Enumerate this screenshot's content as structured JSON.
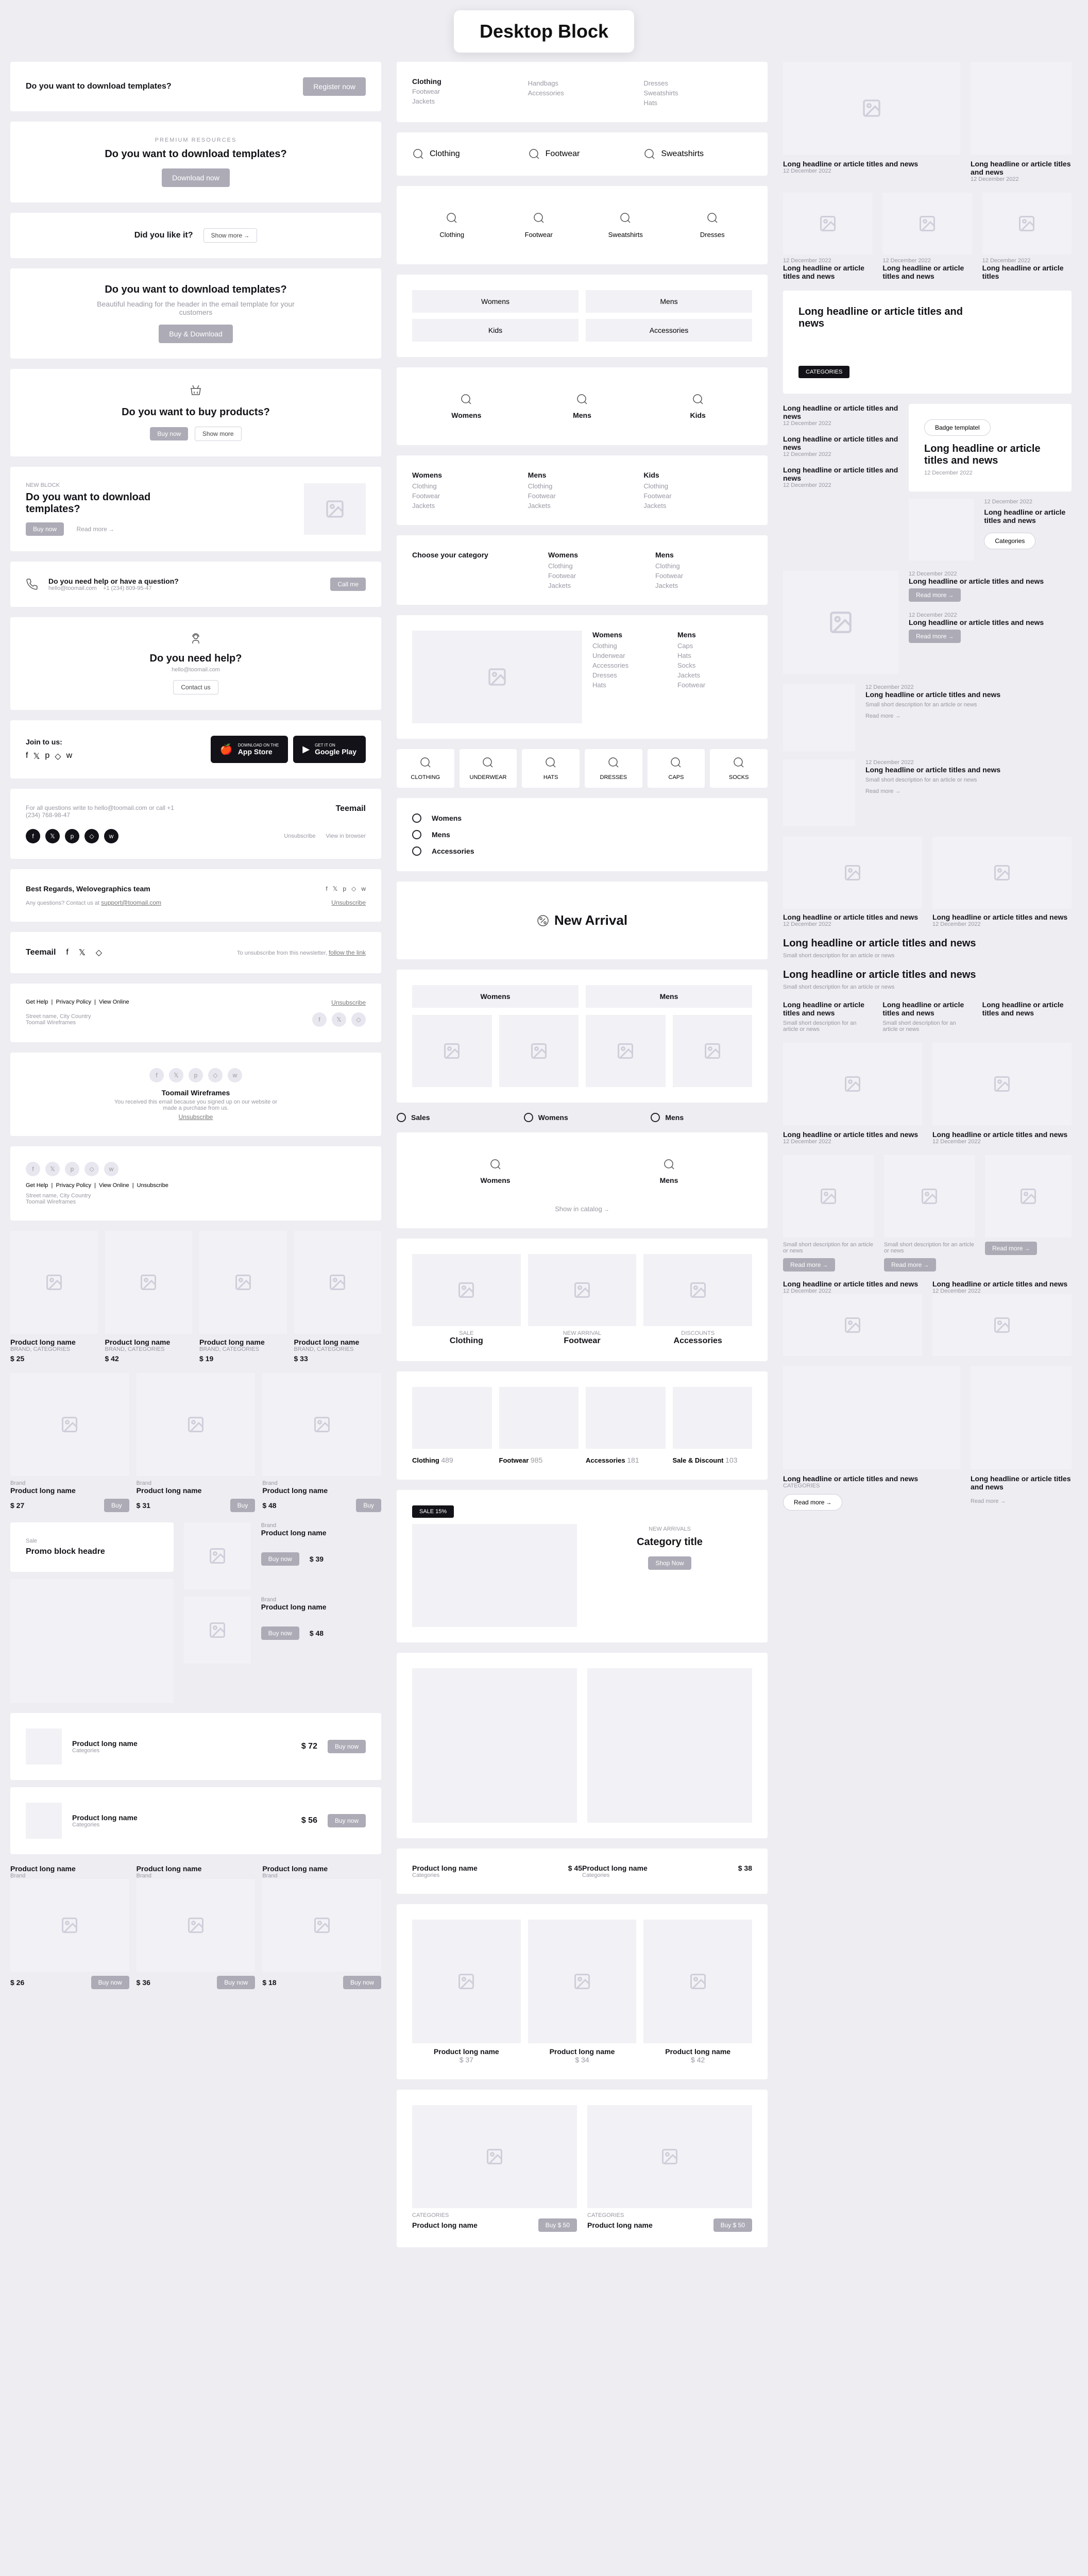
{
  "pageTitle": "Desktop Block",
  "col1": {
    "hero1": {
      "title": "Do you want to download templates?",
      "btn": "Register now"
    },
    "hero2": {
      "over": "PREMIUM RESOURCES",
      "title": "Do you want to download templates?",
      "btn": "Download now"
    },
    "like": {
      "title": "Did you like it?",
      "btn": "Show more"
    },
    "hero3": {
      "title": "Do you want to download templates?",
      "sub": "Beautiful heading for the header in the email template for your customers",
      "btn": "Buy & Download"
    },
    "hero4": {
      "title": "Do you want to buy products?",
      "btn1": "Buy now",
      "btn2": "Show more"
    },
    "hero5": {
      "over": "NEW BLOCK",
      "title": "Do you want to download templates?",
      "btn": "Buy now",
      "link": "Read more"
    },
    "help1": {
      "title": "Do you need help or have a question?",
      "email": "hello@toomail.com",
      "phone": "+1 (234) 809-95-47",
      "btn": "Call me"
    },
    "help2": {
      "title": "Do you need help?",
      "email": "hello@toomail.com",
      "btn": "Contact us"
    },
    "apps": {
      "join": "Join to us:",
      "appstore1": "DOWNLOAD ON THE",
      "appstore2": "App Store",
      "gplay1": "GET IT ON",
      "gplay2": "Google Play"
    },
    "foot1": {
      "text": "For all questions write to hello@toomail.com or call +1 (234) 768-98-47",
      "brand": "Teemail",
      "unsub": "Unsubscribe",
      "view": "View in browser"
    },
    "foot2": {
      "text": "Best Regards, Welovegraphics team",
      "sub": "Any questions? Contact us at ",
      "email": "support@toomail.com",
      "unsub": "Unsubscribe"
    },
    "foot3": {
      "brand": "Teemail",
      "text": "To unsubscribe from this newsletter, ",
      "link": "follow the link"
    },
    "foot4": {
      "l1": "Get Help",
      "l2": "Privacy Policy",
      "l3": "View Online",
      "addr1": "Street name, City Country",
      "addr2": "Toomail Wireframes",
      "unsub": "Unsubscribe"
    },
    "foot5": {
      "brand": "Toomail Wireframes",
      "text": "You received this email because you signed up on our website or made a purchase from us.",
      "unsub": "Unsubscribe"
    },
    "foot6": {
      "l1": "Get Help",
      "l2": "Privacy Policy",
      "l3": "View Online",
      "l4": "Unsubscribe",
      "addr1": "Street name, City Country",
      "addr2": "Toomail Wireframes"
    },
    "prod4": [
      {
        "name": "Product long name",
        "cat": "BRAND, CATEGORIES",
        "price": "$ 25"
      },
      {
        "name": "Product long name",
        "cat": "BRAND, CATEGORIES",
        "price": "$ 42"
      },
      {
        "name": "Product long name",
        "cat": "BRAND, CATEGORIES",
        "price": "$ 19"
      },
      {
        "name": "Product long name",
        "cat": "BRAND, CATEGORIES",
        "price": "$ 33"
      }
    ],
    "prod3": [
      {
        "brand": "Brand",
        "name": "Product long name",
        "price": "$ 27",
        "btn": "Buy"
      },
      {
        "brand": "Brand",
        "name": "Product long name",
        "price": "$ 31",
        "btn": "Buy"
      },
      {
        "brand": "Brand",
        "name": "Product long name",
        "price": "$ 48",
        "btn": "Buy"
      }
    ],
    "promo": {
      "tag": "Sale",
      "title": "Promo block headre"
    },
    "prodList": [
      {
        "brand": "Brand",
        "name": "Product long name",
        "price": "$ 39",
        "btn": "Buy now"
      },
      {
        "brand": "Brand",
        "name": "Product long name",
        "price": "$ 48",
        "btn": "Buy now"
      }
    ],
    "prodRows": [
      {
        "name": "Product long name",
        "cat": "Categories",
        "price": "$ 72",
        "btn": "Buy now"
      },
      {
        "name": "Product long name",
        "cat": "Categories",
        "price": "$ 56",
        "btn": "Buy now"
      }
    ],
    "prodBottom": [
      {
        "name": "Product long name",
        "brand": "Brand",
        "price": "$ 26",
        "btn": "Buy now"
      },
      {
        "name": "Product long name",
        "brand": "Brand",
        "price": "$ 36",
        "btn": "Buy now"
      },
      {
        "name": "Product long name",
        "brand": "Brand",
        "price": "$ 18",
        "btn": "Buy now"
      }
    ]
  },
  "col2": {
    "catCols": [
      {
        "h": "Clothing",
        "items": [
          "Footwear",
          "Jackets"
        ]
      },
      {
        "h": "",
        "items": [
          "Handbags",
          "Accessories"
        ]
      },
      {
        "h": "",
        "items": [
          "Dresses",
          "Sweatshirts",
          "Hats"
        ]
      }
    ],
    "catTabs3": [
      "Clothing",
      "Footwear",
      "Sweatshirts"
    ],
    "catTiles4": [
      "Clothing",
      "Footwear",
      "Sweatshirts",
      "Dresses"
    ],
    "catTabs22": [
      [
        "Womens",
        "Mens"
      ],
      [
        "Kids",
        "Accessories"
      ]
    ],
    "catIcons3": [
      "Womens",
      "Mens",
      "Kids"
    ],
    "catMega": [
      {
        "h": "Womens",
        "items": [
          "Clothing",
          "Footwear",
          "Jackets"
        ]
      },
      {
        "h": "Mens",
        "items": [
          "Clothing",
          "Footwear",
          "Jackets"
        ]
      },
      {
        "h": "Kids",
        "items": [
          "Clothing",
          "Footwear",
          "Jackets"
        ]
      }
    ],
    "catChoose": {
      "title": "Choose your category",
      "cols": [
        {
          "h": "Womens",
          "items": [
            "Clothing",
            "Footwear",
            "Jackets"
          ]
        },
        {
          "h": "Mens",
          "items": [
            "Clothing",
            "Footwear",
            "Jackets"
          ]
        }
      ]
    },
    "catSide": {
      "cols": [
        {
          "h": "Womens",
          "items": [
            "Clothing",
            "Underwear",
            "Accessories",
            "Dresses",
            "Hats"
          ]
        },
        {
          "h": "Mens",
          "items": [
            "Caps",
            "Hats",
            "Socks",
            "Jackets",
            "Footwear"
          ]
        }
      ]
    },
    "catGrid6": [
      "CLOTHING",
      "UNDERWEAR",
      "HATS",
      "DRESSES",
      "CAPS",
      "SOCKS"
    ],
    "catVert": [
      "Womens",
      "Mens",
      "Accessories"
    ],
    "newArrival": "New Arrival",
    "catHero2": [
      "Womens",
      "Mens"
    ],
    "swm": [
      "Sales",
      "Womens",
      "Mens"
    ],
    "wm2": [
      "Womens",
      "Mens"
    ],
    "showCatalog": "Show in catalog",
    "catTiles3": [
      {
        "over": "SALE",
        "title": "Clothing"
      },
      {
        "over": "NEW ARRIVAL",
        "title": "Footwear"
      },
      {
        "over": "DISCOUNTS",
        "title": "Accessories"
      }
    ],
    "catCount": [
      {
        "name": "Clothing",
        "n": "489"
      },
      {
        "name": "Footwear",
        "n": "985"
      },
      {
        "name": "Accessories",
        "n": "181"
      },
      {
        "name": "Sale & Discount",
        "n": "103"
      }
    ],
    "saleTag": "SALE 15%",
    "catTitleCard": {
      "over": "NEW ARRIVALS",
      "title": "Category title",
      "btn": "Shop Now"
    },
    "prodWide": [
      {
        "name": "Product long name",
        "cat": "Categories",
        "price": "$ 45"
      },
      {
        "name": "Product long name",
        "cat": "Categories",
        "price": "$ 38"
      }
    ],
    "prod3b": [
      {
        "name": "Product long name",
        "price": "$ 37"
      },
      {
        "name": "Product long name",
        "price": "$ 34"
      },
      {
        "name": "Product long name",
        "price": "$ 42"
      }
    ],
    "prodBtm": {
      "cat": "CATEGORIES",
      "name": "Product long name",
      "btn": "Buy $ 50"
    }
  },
  "col3": {
    "art1": {
      "title": "Long headline or article titles and news",
      "date": "12 December 2022"
    },
    "art1b": {
      "title": "Long headline or article titles and news",
      "date": "12 December 2022"
    },
    "artSmall": [
      {
        "date": "12 December 2022",
        "title": "Long headline or article titles and news"
      },
      {
        "date": "12 December 2022",
        "title": "Long headline or article titles and news"
      },
      {
        "date": "12 December 2022",
        "title": "Long headline or article titles"
      }
    ],
    "artBig": {
      "title": "Long headline or article titles and news",
      "btn": "CATEGORIES"
    },
    "artList": [
      {
        "title": "Long headline or article titles and news",
        "date": "12 December 2022"
      },
      {
        "title": "Long headline or article titles and news",
        "date": "12 December 2022"
      },
      {
        "title": "Long headline or article titles and news",
        "date": "12 December 2022"
      }
    ],
    "badge": "Badge templatel",
    "artBadge": {
      "title": "Long headline or article titles and news",
      "date": "12 December 2022"
    },
    "artSide": {
      "date": "12 December 2022",
      "title": "Long headline or article titles and news",
      "btn": "Categories"
    },
    "artRead": [
      {
        "date": "12 December 2022",
        "title": "Long headline or article titles and news",
        "btn": "Read more"
      },
      {
        "date": "12 December 2022",
        "title": "Long headline or article titles and news",
        "btn": "Read more"
      }
    ],
    "artDesc": [
      {
        "date": "12 December 2022",
        "title": "Long headline or article titles and news",
        "desc": "Small short description for an article or news",
        "btn": "Read more"
      },
      {
        "date": "12 December 2022",
        "title": "Long headline or article titles and news",
        "desc": "Small short description for an article or news",
        "btn": "Read more"
      }
    ],
    "art2col": [
      {
        "title": "Long headline or article titles and news",
        "date": "12 December 2022"
      },
      {
        "title": "Long headline or article titles and news",
        "date": "12 December 2022"
      }
    ],
    "artFull": [
      {
        "title": "Long headline or article titles and news",
        "desc": "Small short description for an article or news"
      },
      {
        "title": "Long headline or article titles and news",
        "desc": "Small short description for an article or news"
      }
    ],
    "art3col": [
      {
        "title": "Long headline or article titles and news",
        "desc": "Small short description for an article or news"
      },
      {
        "title": "Long headline or article titles and news",
        "desc": "Small short description for an article or news"
      },
      {
        "title": "Long headline or article titles and news"
      }
    ],
    "artImg2": [
      {
        "title": "Long headline or article titles and news",
        "date": "12 December 2022"
      },
      {
        "title": "Long headline or article titles and news",
        "date": "12 December 2022"
      }
    ],
    "artImg2b": [
      {
        "title": "Long headline or article titles and news",
        "desc": "Small short description for an article or news",
        "btn": "Read more"
      },
      {
        "title": "Long headline or article titles and news",
        "desc": "Small short description for an article or news",
        "btn": "Read more"
      },
      {
        "title": "Long headline or article titles and news",
        "btn": "Read more"
      }
    ],
    "artLast": {
      "title": "Long headline or article titles and news",
      "cat": "CATEGORIES",
      "btn": "Read more"
    },
    "artLastb": {
      "title": "Long headline or article titles and news",
      "btn": "Read more"
    }
  }
}
